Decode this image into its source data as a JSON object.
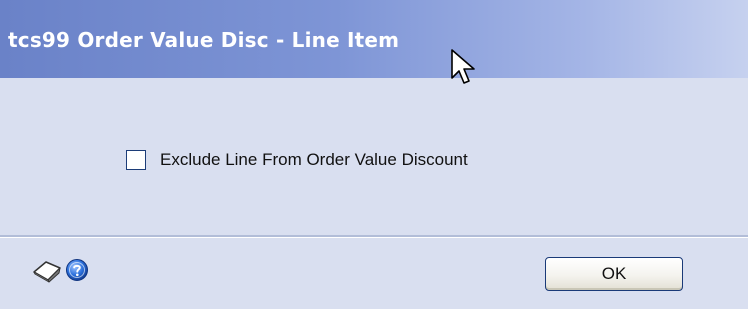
{
  "window": {
    "title": "tcs99 Order Value Disc - Line Item"
  },
  "options": {
    "exclude_line": {
      "label": "Exclude Line From Order Value Discount",
      "checked": false
    }
  },
  "footer": {
    "note_icon": "note-icon",
    "help_icon": "help-icon",
    "ok_label": "OK"
  },
  "colors": {
    "titlebar_start": "#6a82c8",
    "titlebar_end": "#c6d1ef",
    "body_bg": "#d9dff0",
    "checkbox_border": "#1c3c78",
    "button_border": "#1a3a78"
  }
}
